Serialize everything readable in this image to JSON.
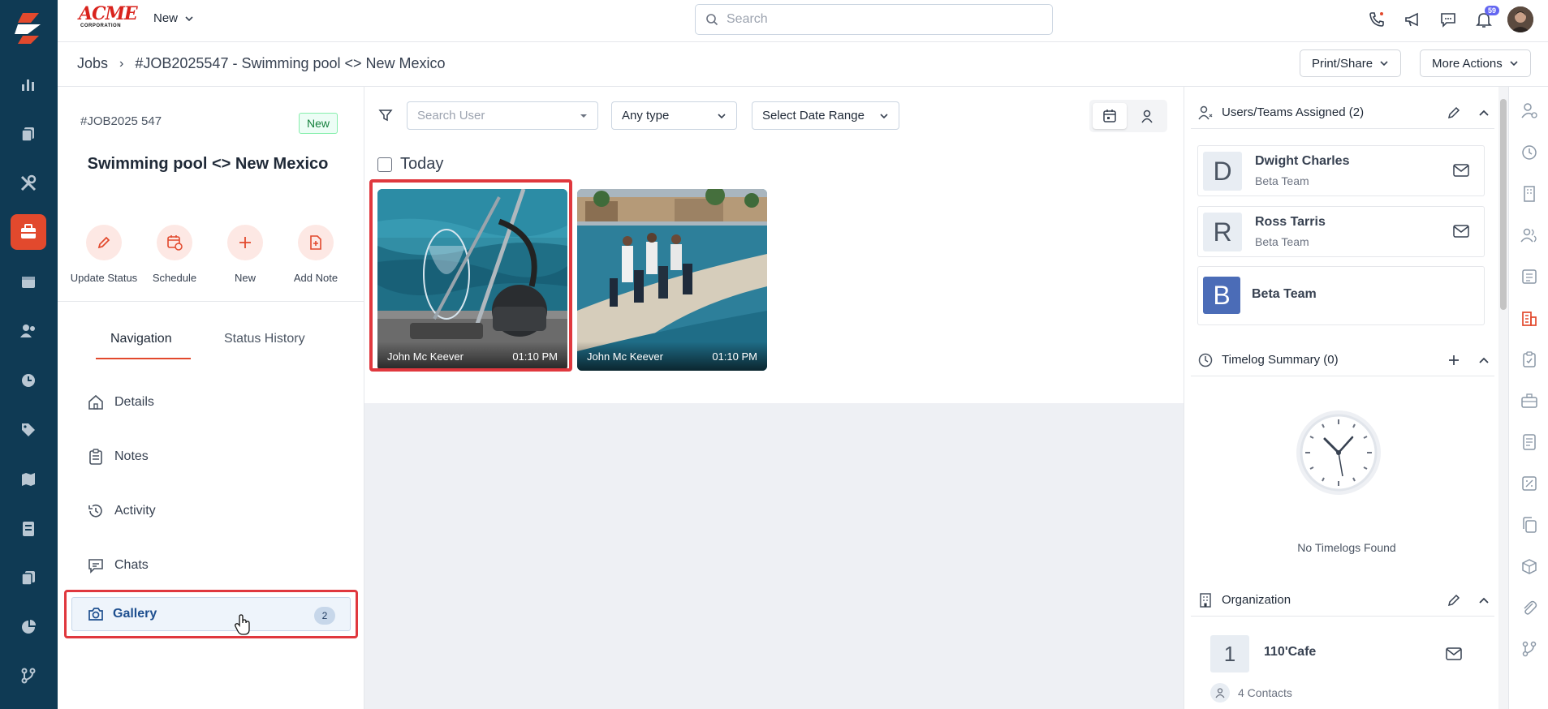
{
  "brand": {
    "name": "ACME",
    "sub": "CORPORATION"
  },
  "topbar": {
    "new_label": "New",
    "search_placeholder": "Search",
    "notification_count": "59"
  },
  "breadcrumb": {
    "root": "Jobs",
    "separator": "›",
    "title": "#JOB2025547 - Swimming pool <> New Mexico"
  },
  "header_actions": {
    "print_share": "Print/Share",
    "more_actions": "More Actions"
  },
  "job": {
    "number": "#JOB2025 547",
    "status": "New",
    "title": "Swimming pool <> New Mexico"
  },
  "quick_actions": [
    {
      "label": "Update Status",
      "icon": "pencil-icon"
    },
    {
      "label": "Schedule",
      "icon": "calendar-clock-icon"
    },
    {
      "label": "New",
      "icon": "plus-icon"
    },
    {
      "label": "Add Note",
      "icon": "note-add-icon"
    }
  ],
  "tabs": {
    "navigation": "Navigation",
    "status_history": "Status History"
  },
  "nav": {
    "details": "Details",
    "notes": "Notes",
    "activity": "Activity",
    "chats": "Chats",
    "gallery": "Gallery",
    "gallery_count": "2"
  },
  "filters": {
    "search_user_placeholder": "Search User",
    "type": "Any type",
    "date_range": "Select Date Range"
  },
  "gallery": {
    "group_label": "Today",
    "photos": [
      {
        "author": "John Mc Keever",
        "time": "01:10 PM"
      },
      {
        "author": "John Mc Keever",
        "time": "01:10 PM"
      }
    ]
  },
  "users_teams": {
    "title": "Users/Teams Assigned (2)",
    "items": [
      {
        "initial": "D",
        "name": "Dwight Charles",
        "team": "Beta Team"
      },
      {
        "initial": "R",
        "name": "Ross Tarris",
        "team": "Beta Team"
      },
      {
        "initial": "B",
        "name": "Beta Team"
      }
    ]
  },
  "timelog": {
    "title": "Timelog Summary (0)",
    "empty": "No Timelogs Found"
  },
  "organization": {
    "title": "Organization",
    "number": "1",
    "name": "110'Cafe",
    "contacts": "4 Contacts"
  },
  "colors": {
    "rail_bg": "#0f3a54",
    "accent": "#e2492d",
    "highlight_red": "#e0383e",
    "link_blue": "#1e4f8f"
  }
}
